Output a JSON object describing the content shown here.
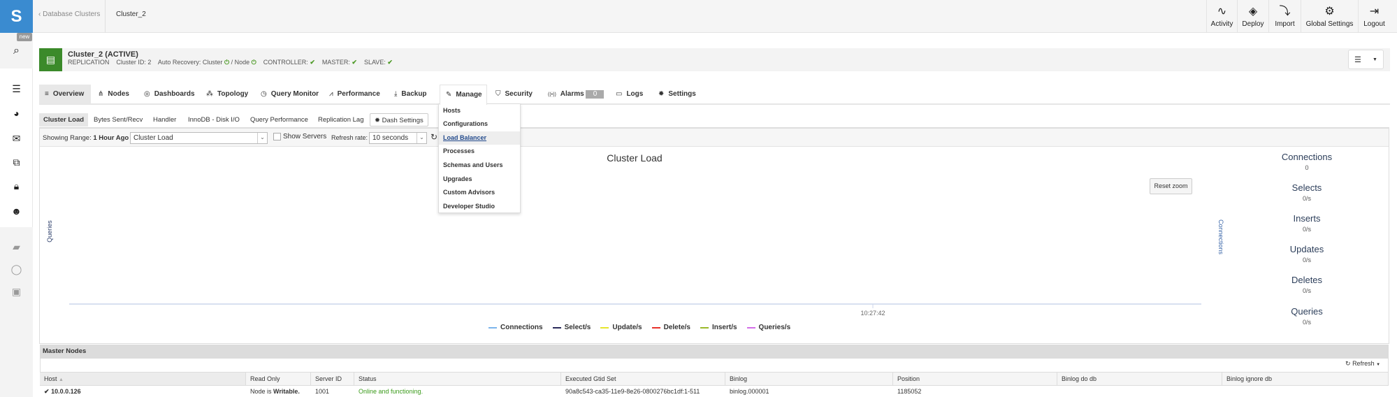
{
  "topbar": {
    "back_label": "Database Clusters",
    "current": "Cluster_2",
    "buttons": [
      {
        "label": "Activity",
        "icon": "activity-icon"
      },
      {
        "label": "Deploy",
        "icon": "layers-icon"
      },
      {
        "label": "Import",
        "icon": "import-icon"
      },
      {
        "label": "Global Settings",
        "icon": "gears-icon"
      },
      {
        "label": "Logout",
        "icon": "logout-icon"
      }
    ]
  },
  "sidebar": {
    "badge": "new",
    "icons": [
      "search-icon",
      "servers-icon",
      "pie-chart-icon",
      "mail-icon",
      "puzzle-icon",
      "lock-icon",
      "users-icon",
      "book-icon",
      "chat-icon",
      "gift-icon"
    ]
  },
  "cluster": {
    "title": "Cluster_2 (ACTIVE)",
    "type": "REPLICATION",
    "cluster_id": "Cluster ID: 2",
    "auto_recovery": "Auto Recovery: Cluster",
    "node": "/ Node",
    "controller": "CONTROLLER:",
    "master": "MASTER:",
    "slave": "SLAVE:"
  },
  "tabs": [
    {
      "label": "Overview",
      "icon": "≡"
    },
    {
      "label": "Nodes",
      "icon": "⋔"
    },
    {
      "label": "Dashboards",
      "icon": "◎"
    },
    {
      "label": "Topology",
      "icon": "⁂"
    },
    {
      "label": "Query Monitor",
      "icon": "◷"
    },
    {
      "label": "Performance",
      "icon": "⩘"
    },
    {
      "label": "Backup",
      "icon": "⤓"
    },
    {
      "label": "Manage",
      "icon": "✎"
    },
    {
      "label": "Security",
      "icon": "⛉"
    },
    {
      "label": "Alarms",
      "icon": "((•))",
      "count": "0"
    },
    {
      "label": "Logs",
      "icon": "▭"
    },
    {
      "label": "Settings",
      "icon": "✹"
    }
  ],
  "manage_menu": [
    "Hosts",
    "Configurations",
    "Load Balancer",
    "Processes",
    "Schemas and Users",
    "Upgrades",
    "Custom Advisors",
    "Developer Studio"
  ],
  "subtabs": [
    "Cluster Load",
    "Bytes Sent/Recv",
    "Handler",
    "InnoDB - Disk I/O",
    "Query Performance",
    "Replication Lag"
  ],
  "dash_settings": "Dash Settings",
  "toolbar": {
    "range_label": "Showing Range:",
    "range_value": "1 Hour Ago",
    "dashboard_select": "Cluster Load",
    "show_servers": "Show Servers",
    "show_servers_checked": false,
    "refresh_label": "Refresh rate:",
    "refresh_value": "10 seconds"
  },
  "chart_data": {
    "type": "line",
    "title": "Cluster Load",
    "ylabel": "Queries",
    "ylabel_right": "Connections",
    "x_ticks": [
      "10:27:42"
    ],
    "reset_zoom": "Reset zoom",
    "series": [
      {
        "name": "Connections",
        "color": "#7cb5ec",
        "values": []
      },
      {
        "name": "Select/s",
        "color": "#2b2b5a",
        "values": []
      },
      {
        "name": "Update/s",
        "color": "#e6e62e",
        "values": []
      },
      {
        "name": "Delete/s",
        "color": "#e8322c",
        "values": []
      },
      {
        "name": "Insert/s",
        "color": "#9bba2b",
        "values": []
      },
      {
        "name": "Queries/s",
        "color": "#d36ee8",
        "values": []
      }
    ]
  },
  "stats": [
    {
      "name": "Connections",
      "value": "0"
    },
    {
      "name": "Selects",
      "value": "0/s"
    },
    {
      "name": "Inserts",
      "value": "0/s"
    },
    {
      "name": "Updates",
      "value": "0/s"
    },
    {
      "name": "Deletes",
      "value": "0/s"
    },
    {
      "name": "Queries",
      "value": "0/s"
    }
  ],
  "master_nodes": {
    "title": "Master Nodes",
    "refresh": "Refresh",
    "columns": [
      "Host",
      "Read Only",
      "Server ID",
      "Status",
      "Executed Gtid Set",
      "Binlog",
      "Position",
      "Binlog do db",
      "Binlog ignore db"
    ],
    "rows": [
      {
        "host": "10.0.0.126",
        "read_only_prefix": "Node is ",
        "read_only": "Writable.",
        "server_id": "1001",
        "status": "Online and functioning.",
        "gtid": "90a8c543-ca35-11e9-8e26-0800276bc1df:1-511",
        "binlog": "binlog.000001",
        "position": "1185052",
        "binlog_do_db": "",
        "binlog_ignore_db": ""
      }
    ]
  },
  "colors": {
    "brand": "#3a8bd0",
    "cluster_active": "#3b8a2a",
    "ok": "#4d9a26",
    "status_ok": "#3a9a1a"
  }
}
